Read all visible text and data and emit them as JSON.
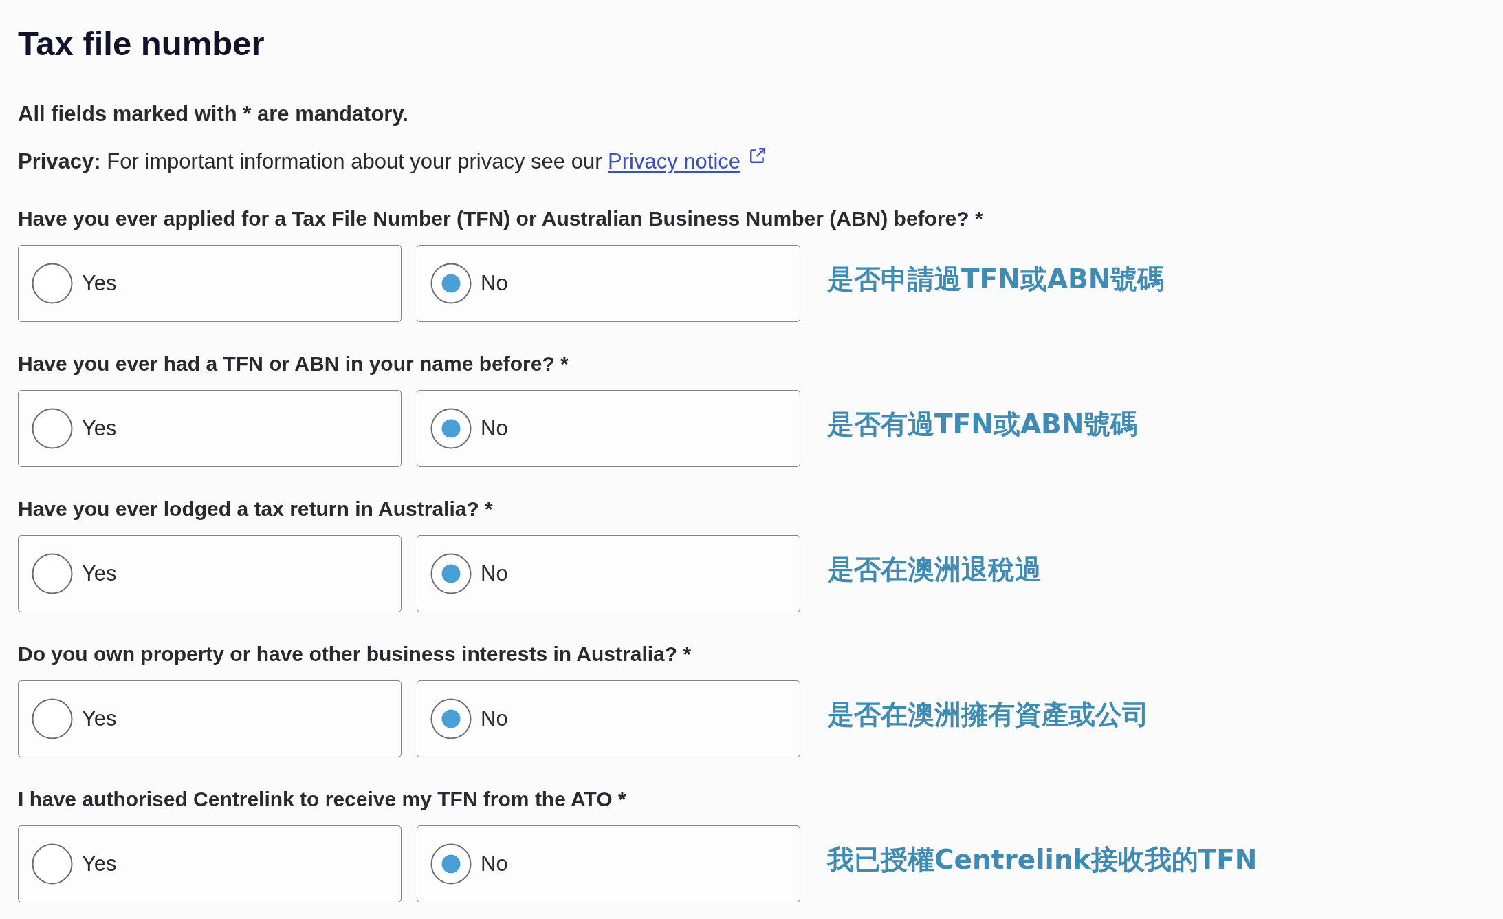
{
  "title": "Tax file number",
  "mandatory_note": "All fields marked with * are mandatory.",
  "privacy": {
    "text": "**Privacy:** For important information about your privacy see our",
    "link": "Privacy notice"
  },
  "questions": [
    {
      "label": "Have you ever applied for a Tax File Number (TFN) or Australian Business Number (ABN) before? *",
      "options": [
        {
          "label": "Yes",
          "selected": false
        },
        {
          "label": "No",
          "selected": true
        }
      ],
      "annotation": "是否申請過TFN或ABN號碼"
    },
    {
      "label": "Have you ever had a TFN or ABN in your name before? *",
      "options": [
        {
          "label": "Yes",
          "selected": false
        },
        {
          "label": "No",
          "selected": true
        }
      ],
      "annotation": "是否有過TFN或ABN號碼"
    },
    {
      "label": "Have you ever lodged a tax return in Australia? *",
      "options": [
        {
          "label": "Yes",
          "selected": false
        },
        {
          "label": "No",
          "selected": true
        }
      ],
      "annotation": "是否在澳洲退稅過"
    },
    {
      "label": "Do you own property or have other business interests in Australia? *",
      "options": [
        {
          "label": "Yes",
          "selected": false
        },
        {
          "label": "No",
          "selected": true
        }
      ],
      "annotation": "是否在澳洲擁有資產或公司"
    },
    {
      "label": "I have authorised Centrelink to receive my TFN from the ATO *",
      "options": [
        {
          "label": "Yes",
          "selected": false
        },
        {
          "label": "No",
          "selected": true
        }
      ],
      "annotation": "我已授權Centrelink接收我的TFN"
    }
  ]
}
